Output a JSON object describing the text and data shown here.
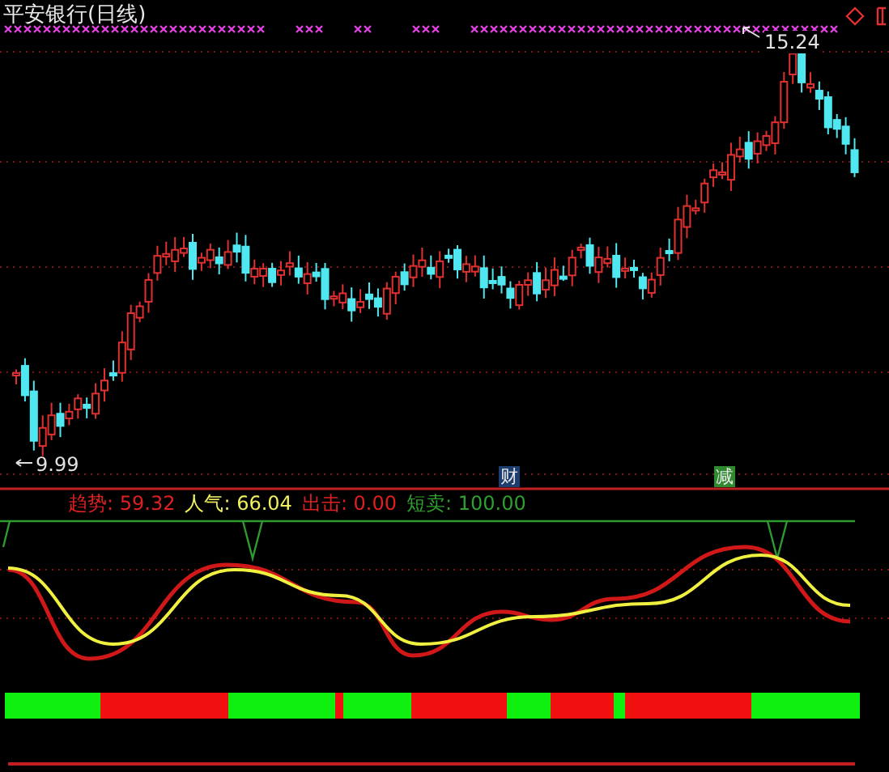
{
  "title": "平安银行(日线)",
  "price_chart": {
    "high_label": "15.24",
    "low_label": "9.99",
    "markers": [
      {
        "text": "财",
        "color": "#1c3d6e"
      },
      {
        "text": "减",
        "color": "#2f8a2f"
      }
    ]
  },
  "indicator": {
    "values": [
      {
        "text": "趋势: 59.32",
        "color": "#e02020"
      },
      {
        "text": "人气: 66.04",
        "color": "#f0f060"
      },
      {
        "text": "出击: 0.00",
        "color": "#e02020"
      },
      {
        "text": "短卖: 100.00",
        "color": "#2fa02f"
      }
    ]
  }
}
